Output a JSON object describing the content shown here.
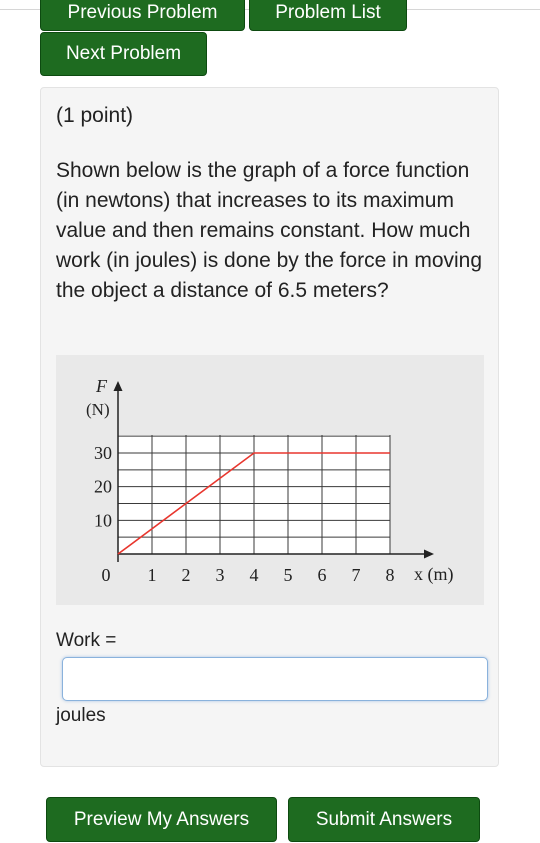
{
  "nav": {
    "previous_label": "Previous Problem",
    "list_label": "Problem List",
    "next_label": "Next Problem"
  },
  "problem": {
    "points": "(1 point)",
    "text": "Shown below is the graph of a force function (in newtons) that increases to its maximum value and then remains constant. How much work (in joules) is done by the force in moving the object a distance of 6.5 meters?"
  },
  "answer": {
    "label": "Work =",
    "value": "",
    "units": "joules"
  },
  "buttons": {
    "preview_label": "Preview My Answers",
    "submit_label": "Submit Answers"
  },
  "colors": {
    "button_green": "#1e6b20",
    "line_red": "#e8362e"
  },
  "chart_data": {
    "type": "line",
    "x": [
      0,
      4,
      8
    ],
    "y": [
      0,
      30,
      30
    ],
    "xticks": [
      "0",
      "1",
      "2",
      "3",
      "4",
      "5",
      "6",
      "7",
      "8"
    ],
    "yticks": [
      "10",
      "20",
      "30"
    ],
    "xlabel": "x (m)",
    "ylabel_var": "F",
    "ylabel_unit": "(N)",
    "xlim": [
      0,
      8
    ],
    "ylim": [
      0,
      30
    ],
    "grid": true
  }
}
